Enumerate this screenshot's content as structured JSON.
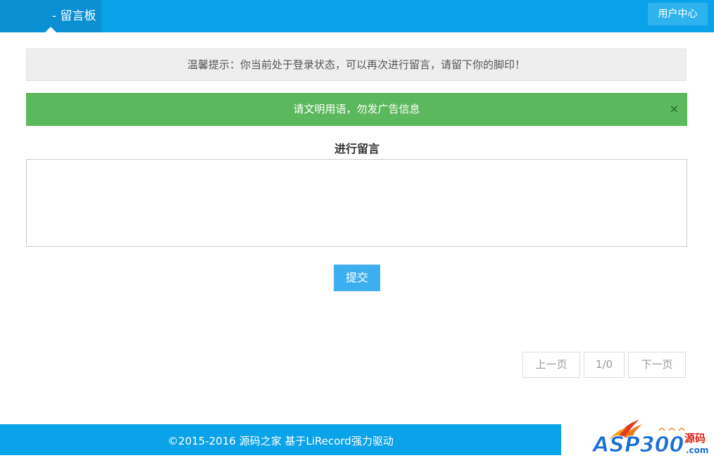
{
  "header": {
    "brand_title": "- 留言板",
    "user_center_label": "用户中心"
  },
  "notices": {
    "login_tip": "温馨提示：你当前处于登录状态，可以再次进行留言，请留下你的脚印！",
    "rule_alert": "请文明用语，勿发广告信息",
    "close_symbol": "×"
  },
  "compose": {
    "title": "进行留言",
    "textarea_value": "",
    "submit_label": "提交"
  },
  "pagination": {
    "prev_label": "上一页",
    "page_info": "1/0",
    "next_label": "下一页"
  },
  "footer": {
    "text": "©2015-2016 源码之家 基于LiRecord强力驱动"
  },
  "watermark": {
    "logo_text": "ASP300",
    "logo_suffix": "源码",
    "logo_domain": ".com"
  },
  "colors": {
    "primary": "#0aa2e8",
    "brand_dark": "#0a8fd2",
    "success": "#5cb85c",
    "tip_background": "#eeeeee"
  }
}
